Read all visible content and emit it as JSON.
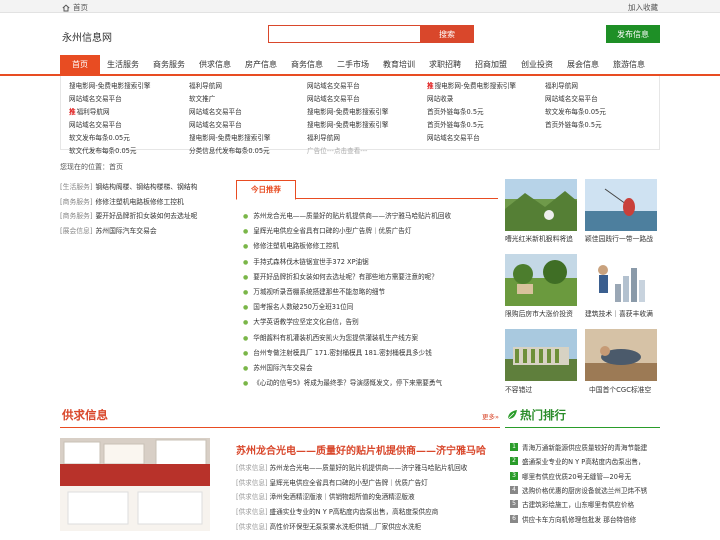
{
  "topbar": {
    "home": "首页",
    "favorite": "加入收藏"
  },
  "header": {
    "logo": "永州信息网",
    "search_button": "搜索",
    "publish_button": "发布信息"
  },
  "nav": [
    "首页",
    "生活服务",
    "商务服务",
    "供求信息",
    "房产信息",
    "商务信息",
    "二手市场",
    "教育培训",
    "求职招聘",
    "招商加盟",
    "创业投资",
    "展会信息",
    "旅游信息"
  ],
  "links": [
    [
      "搜电影网-免费电影搜索引擎",
      "网站域名交易平台",
      "推|福利导航网",
      "网站域名交易平台",
      "软文发布每条0.05元",
      "软文代发布每条0.05元"
    ],
    [
      "福利导航网",
      "软文推广",
      "网站域名交易平台",
      "网站域名交易平台",
      "搜电影网-免费电影搜索引擎",
      "分类信息代发布每条0.05元"
    ],
    [
      "网站域名交易平台",
      "网站域名交易平台",
      "搜电影网-免费电影搜索引擎",
      "搜电影网-免费电影搜索引擎",
      "福利导航网",
      "广告位---点击查看---"
    ],
    [
      "推|搜电影网-免费电影搜索引擎",
      "网站收录",
      "首页外链每条0.5元",
      "首页外链每条0.5元",
      "网站域名交易平台"
    ],
    [
      "福利导航网",
      "网站域名交易平台",
      "软文发布每条0.05元",
      "首页外链每条0.5元"
    ]
  ],
  "breadcrumb": "您现在的位置：首页",
  "left_list": [
    {
      "cat": "[生活服务]",
      "text": "钢结构阁楼、钢结构楼梯、钢结构"
    },
    {
      "cat": "[商务服务]",
      "text": "修修注塑机电路板修修工控机"
    },
    {
      "cat": "[商务服务]",
      "text": "要开好品牌折扣女装如何去选址呢"
    },
    {
      "cat": "[展会信息]",
      "text": "苏州国际汽车交易会"
    }
  ],
  "recommend": {
    "tab": "今日推荐",
    "items": [
      "苏州龙合光电——质量好的贴片机提供商——济宁雅马哈贴片机回收",
      "皇辉光电供应全省具有口碑的小型广告牌｜优质广告灯",
      "修修注塑机电路板修修工控机",
      "手持式森林伐木链锯宣世手372 XP油锯",
      "要开好品牌折扣女装如何去选址呢？有那些地方需要注意的呢？",
      "万城视听录音棚系统搭建那些不能忽略的细节",
      "国考报名人数破250万全班31位同",
      "大学英语教学应坚定文化自信，告别",
      "华朗酱料有机灌装机西安凯火为您提供灌装机生产线方案",
      "台州专做注射模具厂 171.密封桶模具 181.密封桶模具多少钱",
      "苏州国际汽车交易会",
      "《心动的信号5》将成为最终季？导演感慨发文，停下来需要勇气"
    ]
  },
  "thumbs": [
    {
      "caption": "嘈光红米新机狠料将追"
    },
    {
      "caption": "颖佳园践行一带一路战"
    },
    {
      "caption": "限购后房市大涨价投资"
    },
    {
      "caption": "建筑技术｜喜获丰收满"
    },
    {
      "caption": "不容错过"
    },
    {
      "caption": "中国首个CGC标准空"
    }
  ],
  "supply": {
    "title": "供求信息",
    "more": "更多»",
    "headline": "苏州龙合光电——质量好的贴片机提供商——济宁雅马哈",
    "items": [
      {
        "cat": "[供求信息]",
        "text": "苏州龙合光电——质量好的贴片机提供商——济宁雅马哈贴片机回收"
      },
      {
        "cat": "[供求信息]",
        "text": "皇辉光电供应全省具有口碑的小型广告牌｜优质广告灯"
      },
      {
        "cat": "[供求信息]",
        "text": "漳州免酒精涩版液｜供销物超所值的免酒精涩版液"
      },
      {
        "cat": "[供求信息]",
        "text": "盛通实业专业的N Y P高粘度内齿泵出售，高粘度泵供应商"
      },
      {
        "cat": "[供求信息]",
        "text": "高性价环保型无泵泵雾水洗柜供销＿厂家供应水洗柜"
      }
    ]
  },
  "hot": {
    "title": "热门排行",
    "items": [
      "青海万通新能源供应质量较好的青海节能建",
      "盛通泵业专业的N Y P高粘度内齿泵出售，",
      "哪里有供应优质20号无缝管—20号无",
      "选购价格优惠的厨房设备就选兰州卫炜不锈",
      "古建筑彩绘施工，山东哪里有供应价格",
      "供应卡车方向机修理包批发 那台特倍修"
    ]
  },
  "colors": {
    "accent": "#e84c22",
    "green": "#1e8f26"
  }
}
